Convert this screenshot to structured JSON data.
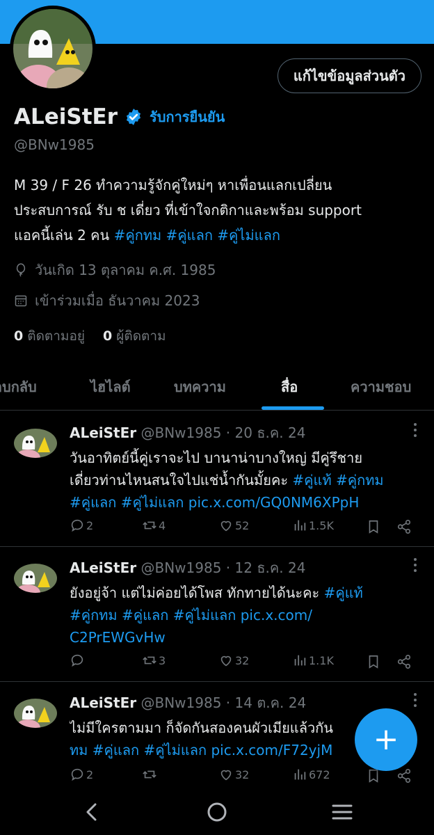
{
  "profile": {
    "edit_label": "แก้ไขข้อมูลส่วนตัว",
    "name": "ALeiStEr",
    "get_verified": "รับการยืนยัน",
    "handle": "@BNw1985",
    "bio_line1": "M 39 / F 26 ทำความรู้จักคู่ใหม่ๆ หาเพื่อนแลกเปลี่ยน",
    "bio_line2": "ประสบการณ์ รับ ช เดี่ยว ที่เข้าใจกติกาและพร้อม support",
    "bio_line3_text": "แอคนี้เล่น 2 คน ",
    "bio_hashtags": "#คู่กทม #คู่แลก #คู่ไม่แลก",
    "birthday": "วันเกิด 13 ตุลาคม ค.ศ. 1985",
    "joined": "เข้าร่วมเมื่อ ธันวาคม 2023",
    "following_count": "0",
    "following_label": "ติดตามอยู่",
    "followers_count": "0",
    "followers_label": "ผู้ติดตาม"
  },
  "tabs": [
    {
      "label": "ตอบกลับ"
    },
    {
      "label": "ไฮไลต์"
    },
    {
      "label": "บทความ"
    },
    {
      "label": "สื่อ"
    },
    {
      "label": "ความชอบ"
    }
  ],
  "active_tab": "สื่อ",
  "posts": [
    {
      "name": "ALeiStEr",
      "handle": "@BNw1985",
      "date": " · 20 ธ.ค. 24",
      "line1": "วันอาทิตย์นี้คู่เราจะไป บานาน่าบางใหญ่ มีคู่รึชาย",
      "line2_text": "เดี่ยวท่านไหนสนใจไปแช่น้ำกันมั้ยคะ ",
      "line2_link": "#คู่แท้ #คู่กทม",
      "line3_link": "#คู่แลก #คู่ไม่แลก pic.x.com/GQ0NM6XPpH",
      "replies": "2",
      "reposts": "4",
      "likes": "52",
      "views": "1.5K"
    },
    {
      "name": "ALeiStEr",
      "handle": "@BNw1985",
      "date": " · 12 ธ.ค. 24",
      "line1_text": "ยังอยู่จ้า แต่ไม่ค่อยได้โพส ทักทายได้นะคะ ",
      "line1_link": "#คู่แท้",
      "line2_link": "#คู่กทม #คู่แลก #คู่ไม่แลก pic.x.com/",
      "line3_link": "C2PrEWGvHw",
      "replies": "",
      "reposts": "3",
      "likes": "32",
      "views": "1.1K"
    },
    {
      "name": "ALeiStEr",
      "handle": "@BNw1985",
      "date": " · 14 ต.ค. 24",
      "line1": "ไม่มีใครตามมา ก็จัดกันสองคนผัวเมียแล้วกัน",
      "line2_link": "ทม #คู่แลก #คู่ไม่แลก pic.x.com/F72yjM",
      "replies": "2",
      "reposts": "",
      "likes": "32",
      "views": "672"
    }
  ],
  "fab_label": "+",
  "colors": {
    "accent": "#1d9bf0",
    "background": "#000000",
    "text": "#e7e9ea",
    "muted": "#71767b",
    "divider": "#2f3336"
  }
}
